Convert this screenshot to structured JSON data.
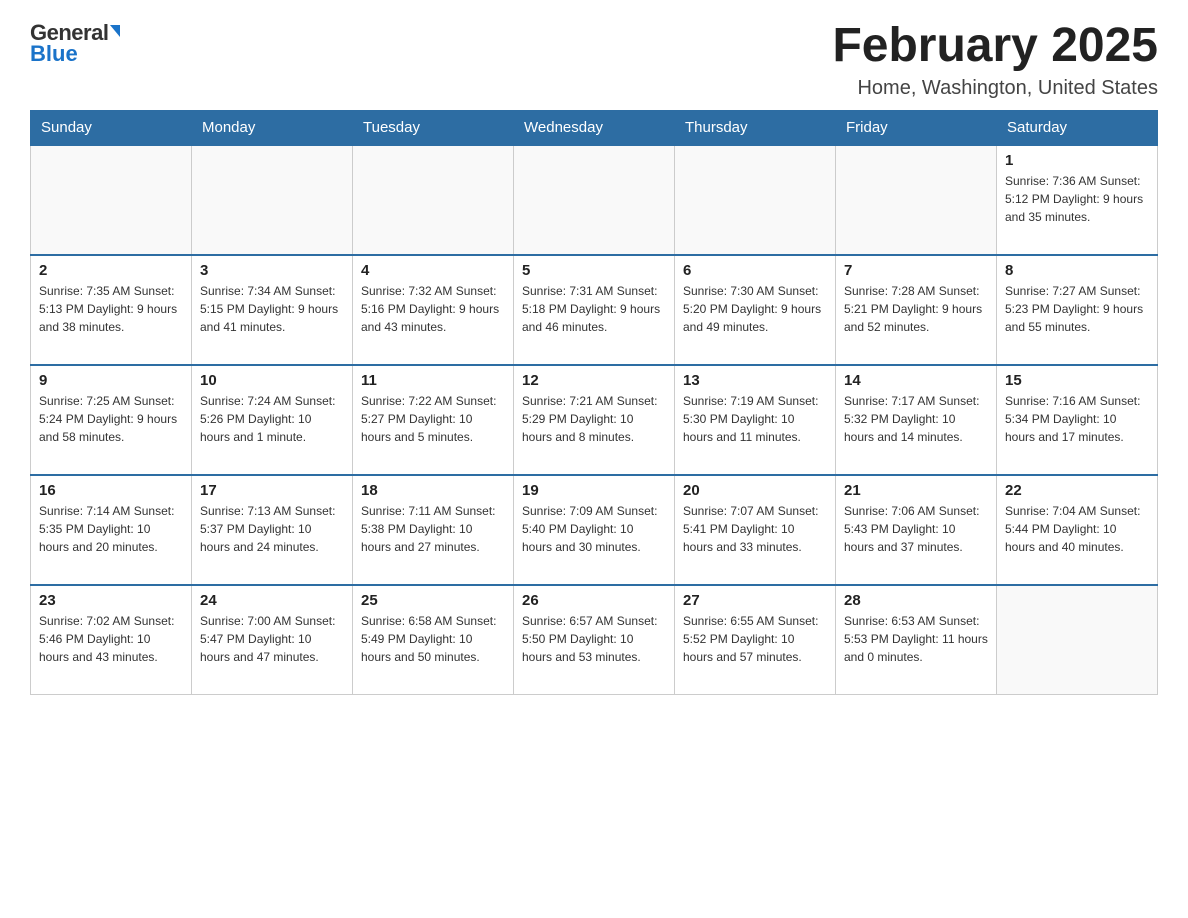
{
  "logo": {
    "general": "General",
    "blue": "Blue",
    "triangle": "▲"
  },
  "title": "February 2025",
  "location": "Home, Washington, United States",
  "days_of_week": [
    "Sunday",
    "Monday",
    "Tuesday",
    "Wednesday",
    "Thursday",
    "Friday",
    "Saturday"
  ],
  "weeks": [
    [
      {
        "day": "",
        "info": ""
      },
      {
        "day": "",
        "info": ""
      },
      {
        "day": "",
        "info": ""
      },
      {
        "day": "",
        "info": ""
      },
      {
        "day": "",
        "info": ""
      },
      {
        "day": "",
        "info": ""
      },
      {
        "day": "1",
        "info": "Sunrise: 7:36 AM\nSunset: 5:12 PM\nDaylight: 9 hours and 35 minutes."
      }
    ],
    [
      {
        "day": "2",
        "info": "Sunrise: 7:35 AM\nSunset: 5:13 PM\nDaylight: 9 hours and 38 minutes."
      },
      {
        "day": "3",
        "info": "Sunrise: 7:34 AM\nSunset: 5:15 PM\nDaylight: 9 hours and 41 minutes."
      },
      {
        "day": "4",
        "info": "Sunrise: 7:32 AM\nSunset: 5:16 PM\nDaylight: 9 hours and 43 minutes."
      },
      {
        "day": "5",
        "info": "Sunrise: 7:31 AM\nSunset: 5:18 PM\nDaylight: 9 hours and 46 minutes."
      },
      {
        "day": "6",
        "info": "Sunrise: 7:30 AM\nSunset: 5:20 PM\nDaylight: 9 hours and 49 minutes."
      },
      {
        "day": "7",
        "info": "Sunrise: 7:28 AM\nSunset: 5:21 PM\nDaylight: 9 hours and 52 minutes."
      },
      {
        "day": "8",
        "info": "Sunrise: 7:27 AM\nSunset: 5:23 PM\nDaylight: 9 hours and 55 minutes."
      }
    ],
    [
      {
        "day": "9",
        "info": "Sunrise: 7:25 AM\nSunset: 5:24 PM\nDaylight: 9 hours and 58 minutes."
      },
      {
        "day": "10",
        "info": "Sunrise: 7:24 AM\nSunset: 5:26 PM\nDaylight: 10 hours and 1 minute."
      },
      {
        "day": "11",
        "info": "Sunrise: 7:22 AM\nSunset: 5:27 PM\nDaylight: 10 hours and 5 minutes."
      },
      {
        "day": "12",
        "info": "Sunrise: 7:21 AM\nSunset: 5:29 PM\nDaylight: 10 hours and 8 minutes."
      },
      {
        "day": "13",
        "info": "Sunrise: 7:19 AM\nSunset: 5:30 PM\nDaylight: 10 hours and 11 minutes."
      },
      {
        "day": "14",
        "info": "Sunrise: 7:17 AM\nSunset: 5:32 PM\nDaylight: 10 hours and 14 minutes."
      },
      {
        "day": "15",
        "info": "Sunrise: 7:16 AM\nSunset: 5:34 PM\nDaylight: 10 hours and 17 minutes."
      }
    ],
    [
      {
        "day": "16",
        "info": "Sunrise: 7:14 AM\nSunset: 5:35 PM\nDaylight: 10 hours and 20 minutes."
      },
      {
        "day": "17",
        "info": "Sunrise: 7:13 AM\nSunset: 5:37 PM\nDaylight: 10 hours and 24 minutes."
      },
      {
        "day": "18",
        "info": "Sunrise: 7:11 AM\nSunset: 5:38 PM\nDaylight: 10 hours and 27 minutes."
      },
      {
        "day": "19",
        "info": "Sunrise: 7:09 AM\nSunset: 5:40 PM\nDaylight: 10 hours and 30 minutes."
      },
      {
        "day": "20",
        "info": "Sunrise: 7:07 AM\nSunset: 5:41 PM\nDaylight: 10 hours and 33 minutes."
      },
      {
        "day": "21",
        "info": "Sunrise: 7:06 AM\nSunset: 5:43 PM\nDaylight: 10 hours and 37 minutes."
      },
      {
        "day": "22",
        "info": "Sunrise: 7:04 AM\nSunset: 5:44 PM\nDaylight: 10 hours and 40 minutes."
      }
    ],
    [
      {
        "day": "23",
        "info": "Sunrise: 7:02 AM\nSunset: 5:46 PM\nDaylight: 10 hours and 43 minutes."
      },
      {
        "day": "24",
        "info": "Sunrise: 7:00 AM\nSunset: 5:47 PM\nDaylight: 10 hours and 47 minutes."
      },
      {
        "day": "25",
        "info": "Sunrise: 6:58 AM\nSunset: 5:49 PM\nDaylight: 10 hours and 50 minutes."
      },
      {
        "day": "26",
        "info": "Sunrise: 6:57 AM\nSunset: 5:50 PM\nDaylight: 10 hours and 53 minutes."
      },
      {
        "day": "27",
        "info": "Sunrise: 6:55 AM\nSunset: 5:52 PM\nDaylight: 10 hours and 57 minutes."
      },
      {
        "day": "28",
        "info": "Sunrise: 6:53 AM\nSunset: 5:53 PM\nDaylight: 11 hours and 0 minutes."
      },
      {
        "day": "",
        "info": ""
      }
    ]
  ]
}
